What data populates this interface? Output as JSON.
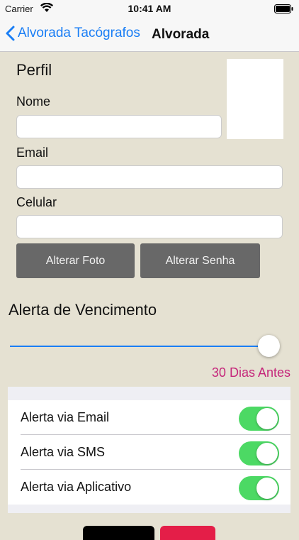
{
  "status_bar": {
    "carrier": "Carrier",
    "time": "10:41 AM"
  },
  "nav": {
    "back_label": "Alvorada Tacógrafos",
    "title": "Alvorada"
  },
  "profile": {
    "section_title": "Perfil",
    "name_label": "Nome",
    "name_value": "",
    "email_label": "Email",
    "email_value": "",
    "phone_label": "Celular",
    "phone_value": "",
    "change_photo_button": "Alterar Foto",
    "change_password_button": "Alterar Senha"
  },
  "expiry_alert": {
    "title": "Alerta de Vencimento",
    "slider_fraction": 1.0,
    "days_label": "30 Dias Antes"
  },
  "alert_settings": [
    {
      "label": "Alerta via Email",
      "enabled": true
    },
    {
      "label": "Alerta via SMS",
      "enabled": true
    },
    {
      "label": "Alerta via Aplicativo",
      "enabled": true
    }
  ],
  "colors": {
    "background": "#e5e1d2",
    "accent": "#1a7ef5",
    "switch_on": "#4cd964",
    "days_text": "#c5267a",
    "button_gray": "#686868"
  }
}
